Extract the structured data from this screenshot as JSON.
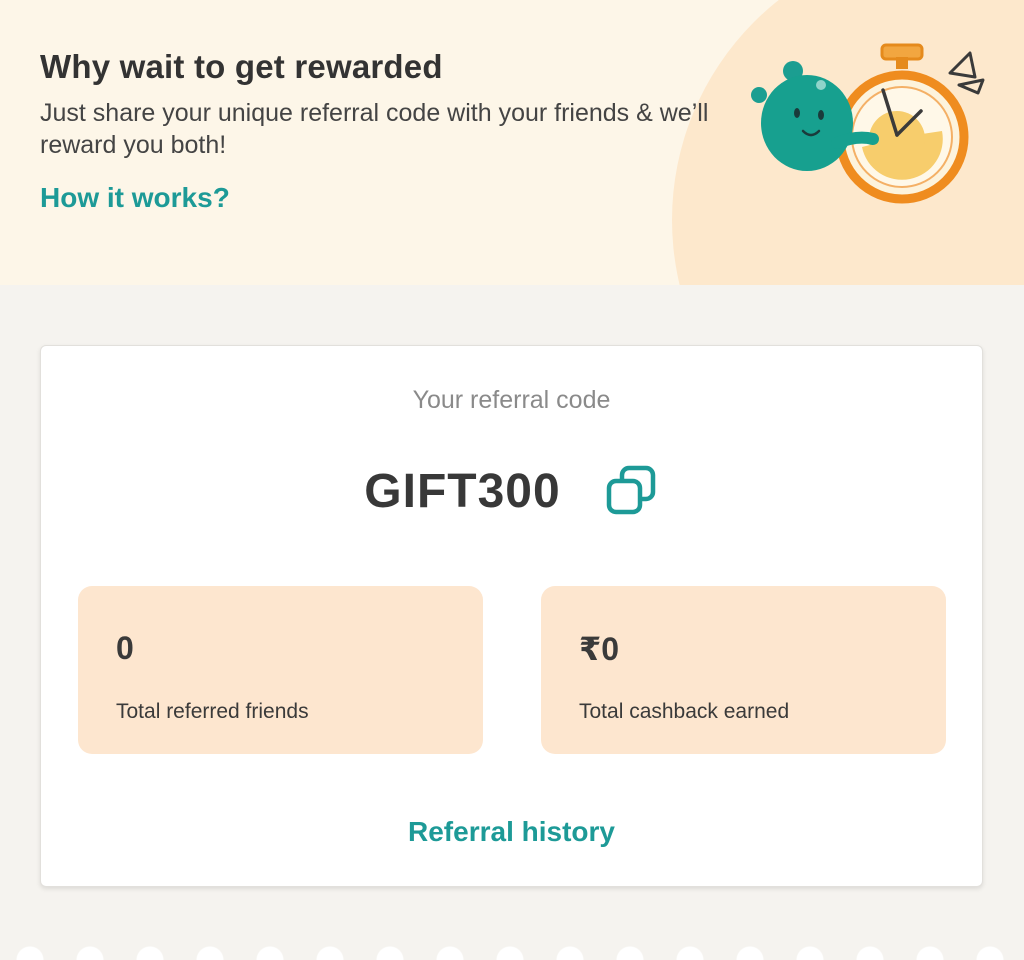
{
  "colors": {
    "accent": "#1d9a97",
    "hero_background": "#fdf6e8",
    "stat_background": "#fde6cf",
    "page_background": "#f5f3ef"
  },
  "hero": {
    "title": "Why wait to get rewarded",
    "subtitle": "Just share your unique referral code with your friends & we’ll reward you both!",
    "how_it_works_label": "How it works?",
    "illustration_icon": "mascot-stopwatch-icon"
  },
  "referral": {
    "code_label": "Your referral code",
    "code": "GIFT300",
    "copy_icon": "copy-icon",
    "stats": [
      {
        "value": "0",
        "label": "Total referred friends"
      },
      {
        "value": "₹0",
        "label": "Total cashback earned"
      }
    ],
    "history_label": "Referral history"
  }
}
